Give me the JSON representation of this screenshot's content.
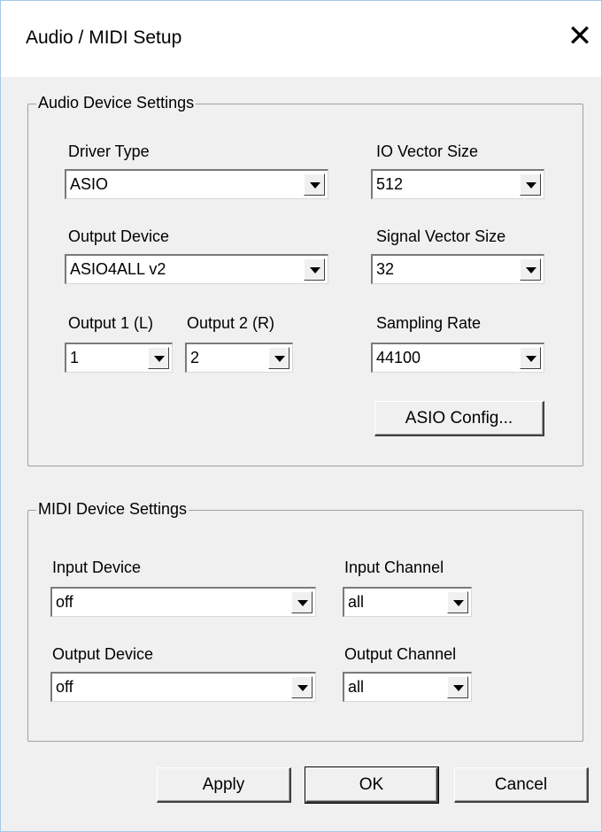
{
  "window": {
    "title": "Audio / MIDI Setup"
  },
  "audio": {
    "group_label": "Audio Device Settings",
    "driver_type": {
      "label": "Driver Type",
      "value": "ASIO"
    },
    "io_vector_size": {
      "label": "IO Vector Size",
      "value": "512"
    },
    "output_device": {
      "label": "Output Device",
      "value": "ASIO4ALL v2"
    },
    "signal_vector_size": {
      "label": "Signal Vector Size",
      "value": "32"
    },
    "output_1": {
      "label": "Output 1 (L)",
      "value": "1"
    },
    "output_2": {
      "label": "Output 2 (R)",
      "value": "2"
    },
    "sampling_rate": {
      "label": "Sampling Rate",
      "value": "44100"
    },
    "asio_config_label": "ASIO Config..."
  },
  "midi": {
    "group_label": "MIDI Device Settings",
    "input_device": {
      "label": "Input Device",
      "value": "off"
    },
    "input_channel": {
      "label": "Input Channel",
      "value": "all"
    },
    "output_device": {
      "label": "Output Device",
      "value": "off"
    },
    "output_channel": {
      "label": "Output Channel",
      "value": "all"
    }
  },
  "buttons": {
    "apply": "Apply",
    "ok": "OK",
    "cancel": "Cancel"
  },
  "icons": {
    "close": "close-icon",
    "dropdown": "chevron-down-icon"
  }
}
